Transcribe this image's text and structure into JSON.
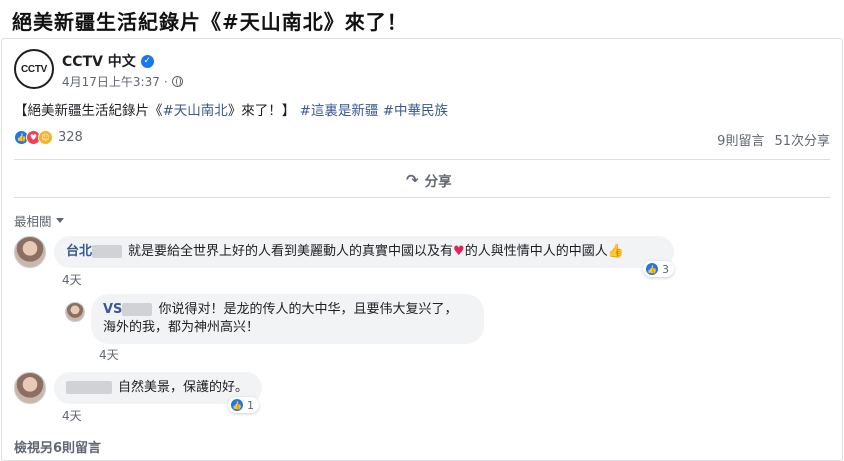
{
  "headline": "絕美新疆生活紀錄片《#天山南北》來了！",
  "post": {
    "avatar_text": "CCTV",
    "page_name": "CCTV 中文",
    "date": "4月17日上午3:37",
    "meta_separator": "·",
    "text_before": "【絕美新疆生活紀錄片《",
    "text_hashtag_inline": "#天山南北",
    "text_after": "》來了！】",
    "hashtags": [
      "#這裏是新疆",
      "#中華民族"
    ],
    "reaction_count": "328",
    "comments_count": "9則留言",
    "shares_count": "51次分享",
    "share_label": "分享"
  },
  "sort_label": "最相關",
  "comments": [
    {
      "author": "台北",
      "text_before": "就是要給全世界上好的人看到美麗動人的真實中國以及有",
      "heart": "♥",
      "text_after": "的人與性情中人的中國人",
      "emoji": "👍",
      "reactions": "3",
      "time": "4天"
    },
    {
      "author": "VS",
      "line1": "你说得对！是龙的传人的大中华，且要伟大复兴了，",
      "line2": "海外的我，都为神州高兴！",
      "time": "4天"
    },
    {
      "author": "",
      "text": "自然美景，保護的好。",
      "reactions": "1",
      "time": "4天"
    }
  ],
  "view_more": "檢視另6則留言",
  "colors": {
    "link": "#385898",
    "like": "#1877f2",
    "love": "#f33e58",
    "muted": "#606770"
  }
}
